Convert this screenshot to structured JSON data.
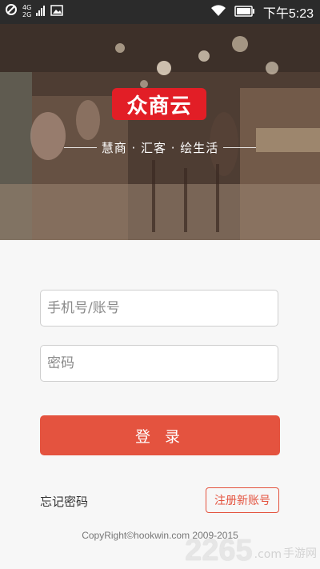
{
  "status_bar": {
    "net_top": "4G",
    "net_bottom": "2G",
    "time": "下午5:23"
  },
  "hero": {
    "logo_text": "众商云",
    "slogan": "慧商 · 汇客 · 绘生活"
  },
  "form": {
    "account_placeholder": "手机号/账号",
    "password_placeholder": "密码",
    "login_label": "登 录",
    "forgot_label": "忘记密码",
    "register_label": "注册新账号"
  },
  "footer": {
    "copyright": "CopyRight©hookwin.com 2009-2015"
  },
  "watermark": {
    "number": "2265",
    "suffix": ".com",
    "text": "手游网"
  },
  "colors": {
    "accent": "#e4533f",
    "logo_red": "#e21e26"
  }
}
